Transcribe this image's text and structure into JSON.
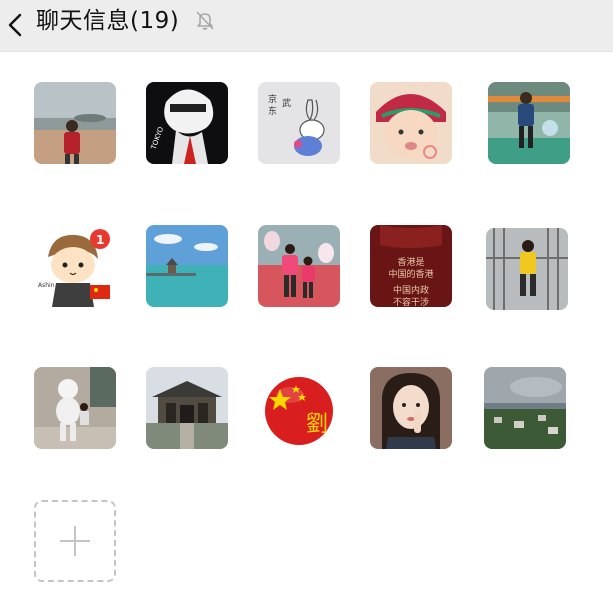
{
  "header": {
    "back_icon": "chevron-left-icon",
    "title": "聊天信息(19)",
    "mute_icon": "bell-slash-icon"
  },
  "members": [
    {
      "name": "member-beach-boy",
      "content": "photo of child at beach"
    },
    {
      "name": "member-anime-white-hair",
      "content": "anime character with white hair",
      "text": "TOKYO"
    },
    {
      "name": "member-drawing-rabbit",
      "content": "hand drawn rabbit with chinese text"
    },
    {
      "name": "member-baby-hat",
      "content": "baby wearing red hat"
    },
    {
      "name": "member-boy-playground",
      "content": "boy at playground"
    },
    {
      "name": "member-cartoon-boy-flag",
      "content": "cartoon boy with chinese flag",
      "text": "Ashin",
      "badge": "1"
    },
    {
      "name": "member-sea-pavilion",
      "content": "pavilion in blue sea"
    },
    {
      "name": "member-kids-balloons",
      "content": "two children with balloons"
    },
    {
      "name": "member-hongkong-text",
      "content": "red background calligraphy",
      "text": [
        "香港是",
        "中国的香港",
        "中国内政",
        "不容干涉"
      ]
    },
    {
      "name": "member-boy-railing",
      "content": "boy in yellow on railing"
    },
    {
      "name": "member-child-robot",
      "content": "child with white robot statue"
    },
    {
      "name": "member-temple",
      "content": "old temple building"
    },
    {
      "name": "member-red-ball-flag",
      "content": "red sphere with stars",
      "text": "劉"
    },
    {
      "name": "member-girl-selfie",
      "content": "girl selfie with hand"
    },
    {
      "name": "member-coastal-town",
      "content": "coastal town landscape"
    }
  ],
  "add_member": {
    "icon": "plus-icon"
  }
}
